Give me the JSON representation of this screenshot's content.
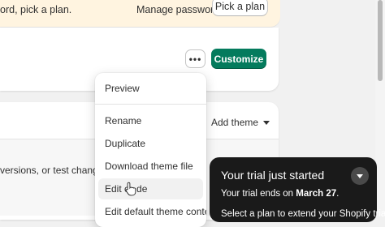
{
  "banner": {
    "text": "ord, pick a plan.",
    "manage_password": "Manage password",
    "pick_plan": "Pick a plan",
    "background": "#fff4e0"
  },
  "current_theme": {
    "more_actions_label": "•••",
    "customize_label": "Customize",
    "accent": "#047b5d"
  },
  "library": {
    "add_theme_label": "Add theme",
    "description_fragment": "versions, or test changes to"
  },
  "menu": {
    "items": [
      {
        "label": "Preview"
      },
      {
        "label": "Rename"
      },
      {
        "label": "Duplicate"
      },
      {
        "label": "Download theme file"
      },
      {
        "label": "Edit code",
        "visible_text_left": "Edit c",
        "visible_text_right": "de"
      },
      {
        "label": "Edit default theme content"
      }
    ]
  },
  "trial": {
    "title": "Your trial just started",
    "ends_prefix": "Your trial ends on ",
    "ends_date": "March 27",
    "ends_suffix": ".",
    "next_line": "Select a plan to extend your Shopify trial",
    "collapse_icon": "chevron-down-icon"
  }
}
